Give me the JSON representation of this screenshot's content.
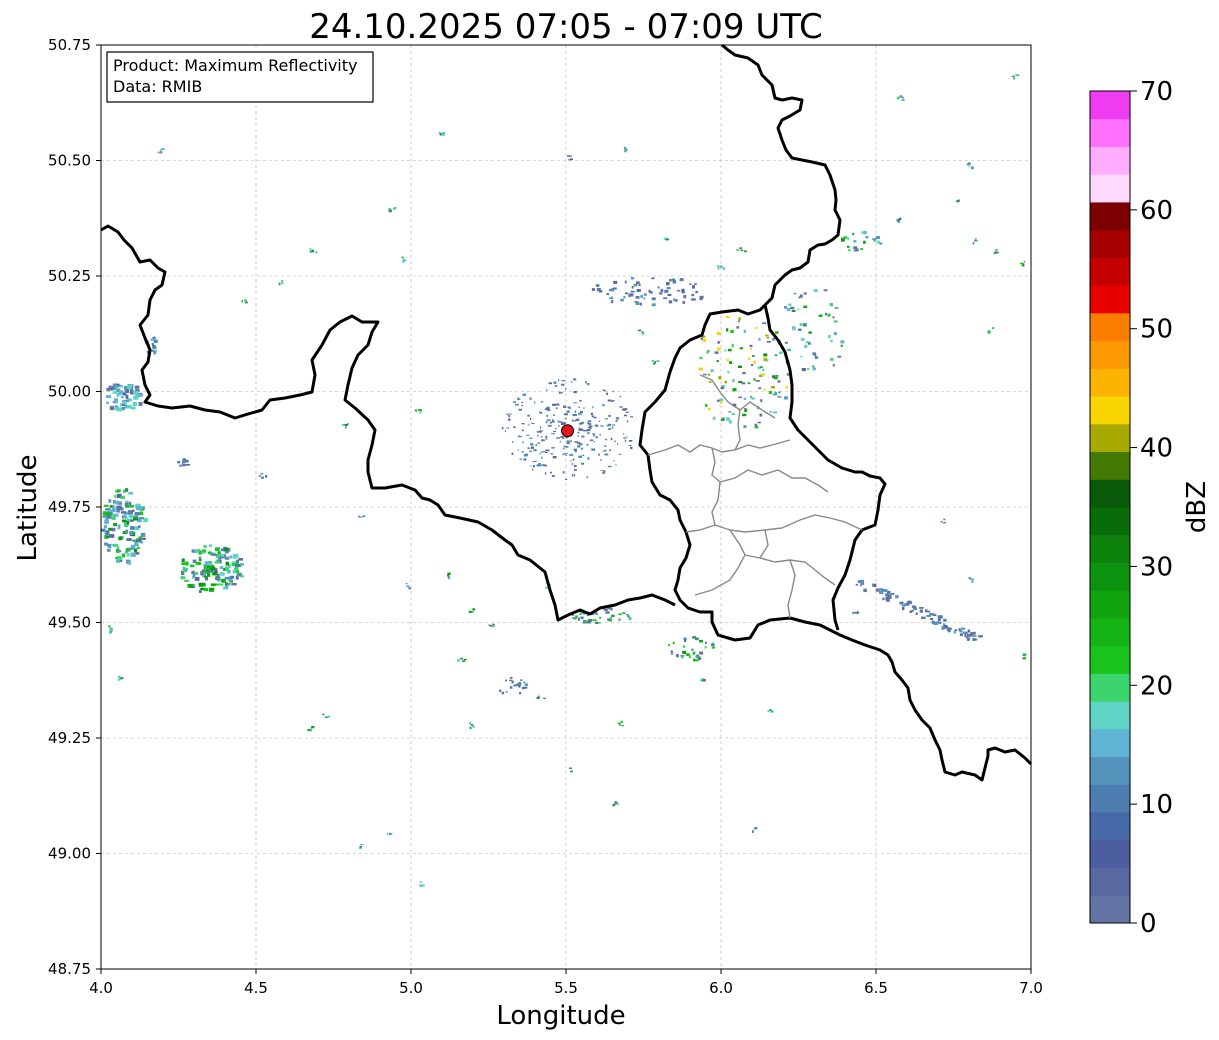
{
  "title": "24.10.2025 07:05 - 07:09 UTC",
  "info_box": {
    "product": "Product: Maximum Reflectivity",
    "source": "Data: RMIB"
  },
  "axes": {
    "xlabel": "Longitude",
    "ylabel": "Latitude",
    "xlim": [
      4.0,
      7.0
    ],
    "ylim": [
      48.75,
      50.75
    ],
    "xticks": [
      "4.0",
      "4.5",
      "5.0",
      "5.5",
      "6.0",
      "6.5",
      "7.0"
    ],
    "yticks": [
      "48.75",
      "49.00",
      "49.25",
      "49.50",
      "49.75",
      "50.00",
      "50.25",
      "50.50",
      "50.75"
    ],
    "grid": true
  },
  "colorbar": {
    "label": "dBZ",
    "range": [
      0,
      70
    ],
    "step": 2.5,
    "tick_labels": [
      "0",
      "10",
      "20",
      "30",
      "40",
      "50",
      "60",
      "70"
    ],
    "colors": [
      "#6474a4",
      "#5868a0",
      "#4c5ea0",
      "#4668a6",
      "#4c7cb0",
      "#5494bc",
      "#60b4d4",
      "#5ed4c4",
      "#3cd46c",
      "#18c41c",
      "#14b414",
      "#10a410",
      "#0c9410",
      "#0c820c",
      "#086c08",
      "#085a08",
      "#447a04",
      "#a8aa00",
      "#f8d400",
      "#fcb400",
      "#fc9800",
      "#fc7e00",
      "#e80000",
      "#c40000",
      "#a40000",
      "#7c0000",
      "#ffd8ff",
      "#ffaeff",
      "#ff70ff",
      "#f03cf0"
    ]
  },
  "radar_site": {
    "lon": 5.505,
    "lat": 49.915,
    "color": "#e8141c"
  }
}
